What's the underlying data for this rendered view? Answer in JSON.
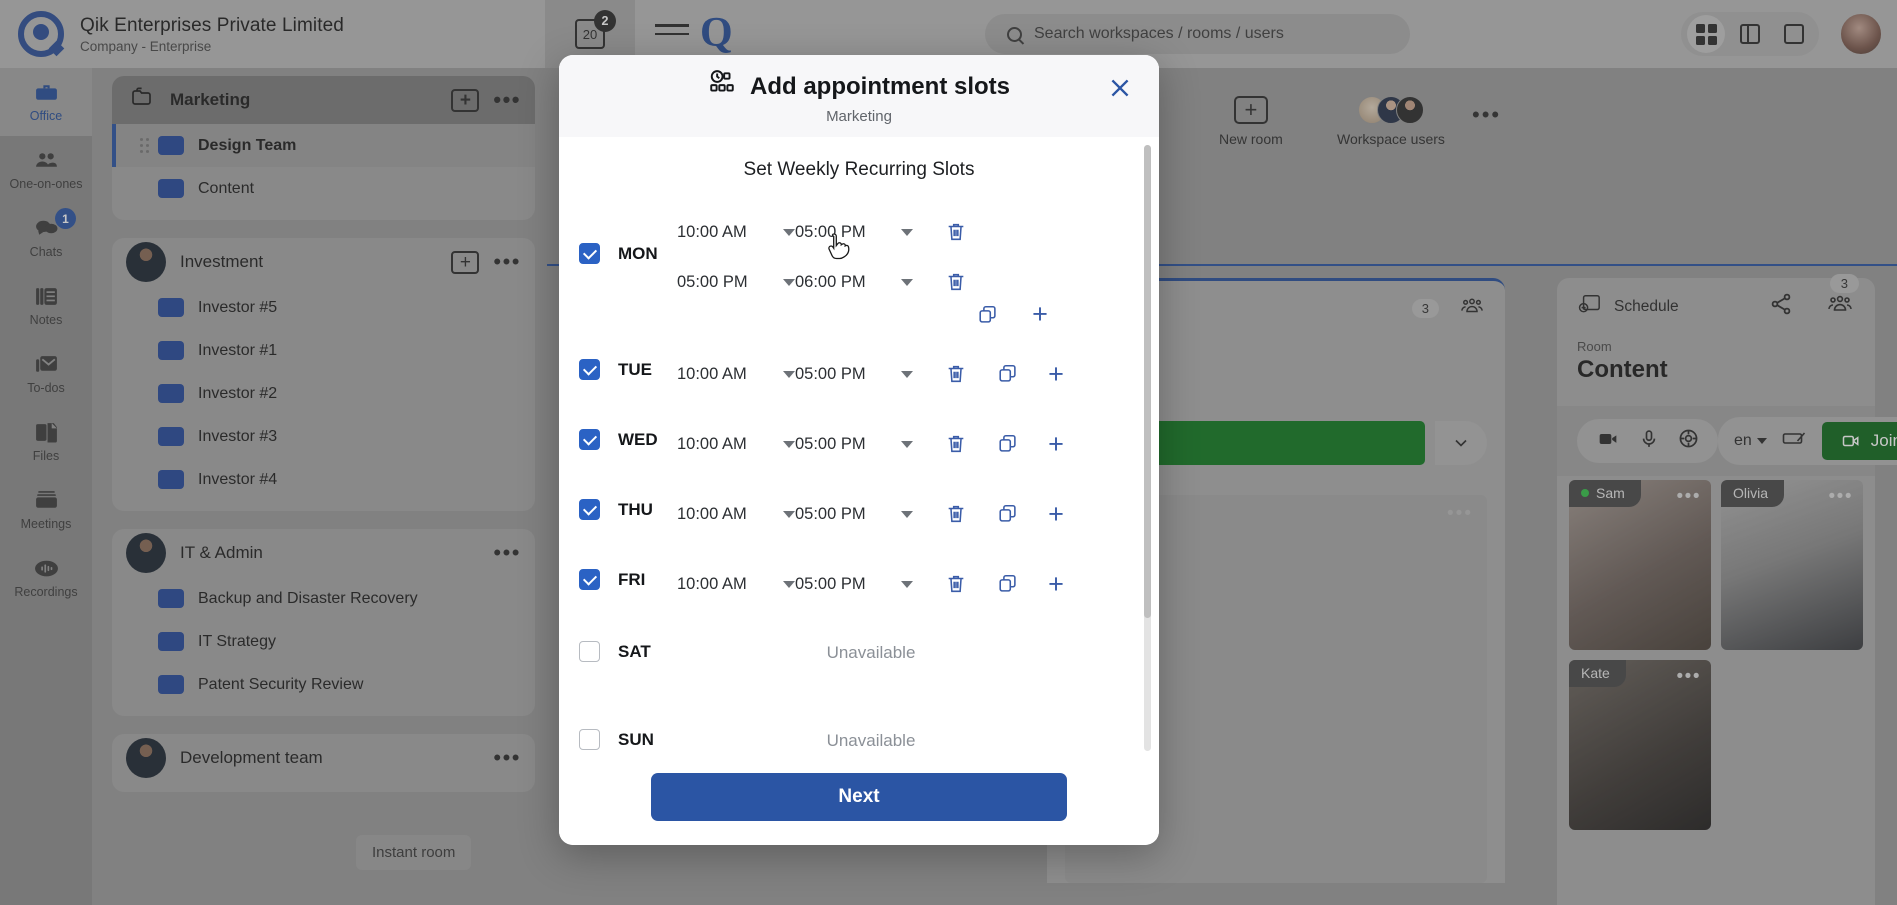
{
  "topbar": {
    "company_name": "Qik Enterprises Private Limited",
    "company_sub": "Company - Enterprise",
    "calendar_day": "20",
    "calendar_badge": "2",
    "search_placeholder": "Search workspaces / rooms / users"
  },
  "rail": {
    "items": [
      {
        "label": "Office",
        "icon": "briefcase-icon",
        "active": true,
        "badge": ""
      },
      {
        "label": "One-on-ones",
        "icon": "people-icon",
        "active": false,
        "badge": ""
      },
      {
        "label": "Chats",
        "icon": "chat-icon",
        "active": false,
        "badge": "1"
      },
      {
        "label": "Notes",
        "icon": "notes-icon",
        "active": false,
        "badge": ""
      },
      {
        "label": "To-dos",
        "icon": "todos-icon",
        "active": false,
        "badge": ""
      },
      {
        "label": "Files",
        "icon": "files-icon",
        "active": false,
        "badge": ""
      },
      {
        "label": "Meetings",
        "icon": "meetings-icon",
        "active": false,
        "badge": ""
      },
      {
        "label": "Recordings",
        "icon": "recordings-icon",
        "active": false,
        "badge": ""
      }
    ]
  },
  "rooms_panel": {
    "workspaces": [
      {
        "name": "Marketing",
        "icon": "folders-icon",
        "rooms": [
          {
            "name": "Design Team",
            "selected": true
          },
          {
            "name": "Content",
            "selected": false
          }
        ]
      },
      {
        "name": "Investment",
        "icon": "avatar",
        "rooms": [
          {
            "name": "Investor #5",
            "selected": false
          },
          {
            "name": "Investor #1",
            "selected": false
          },
          {
            "name": "Investor #2",
            "selected": false
          },
          {
            "name": "Investor #3",
            "selected": false
          },
          {
            "name": "Investor #4",
            "selected": false
          }
        ]
      },
      {
        "name": "IT & Admin",
        "icon": "avatar",
        "rooms": [
          {
            "name": "Backup and Disaster Recovery",
            "selected": false
          },
          {
            "name": "IT Strategy",
            "selected": false
          },
          {
            "name": "Patent Security Review",
            "selected": false
          }
        ]
      },
      {
        "name": "Development team",
        "icon": "avatar",
        "rooms": []
      }
    ],
    "instant_room_tooltip": "Instant room"
  },
  "stage": {
    "new_room_label": "New room",
    "workspace_users_label": "Workspace users",
    "schedule_card": {
      "title": "Schedule",
      "participants_count": "3"
    },
    "right_card": {
      "title": "Schedule",
      "participants_count": "3",
      "room_label": "Room",
      "room_name": "Content",
      "language": "en",
      "join_label": "Join",
      "tiles": [
        {
          "name": "Sam",
          "online": true
        },
        {
          "name": "Olivia",
          "online": false
        },
        {
          "name": "Kate",
          "online": false
        }
      ]
    }
  },
  "modal": {
    "icon": "appointment-slots-icon",
    "title": "Add appointment slots",
    "subtitle": "Marketing",
    "section_title": "Set Weekly Recurring Slots",
    "next_label": "Next",
    "unavailable_label": "Unavailable",
    "days": [
      {
        "day": "MON",
        "checked": true,
        "slots": [
          {
            "start": "10:00 AM",
            "end": "05:00 PM"
          },
          {
            "start": "05:00 PM",
            "end": "06:00 PM"
          }
        ]
      },
      {
        "day": "TUE",
        "checked": true,
        "slots": [
          {
            "start": "10:00 AM",
            "end": "05:00 PM"
          }
        ]
      },
      {
        "day": "WED",
        "checked": true,
        "slots": [
          {
            "start": "10:00 AM",
            "end": "05:00 PM"
          }
        ]
      },
      {
        "day": "THU",
        "checked": true,
        "slots": [
          {
            "start": "10:00 AM",
            "end": "05:00 PM"
          }
        ]
      },
      {
        "day": "FRI",
        "checked": true,
        "slots": [
          {
            "start": "10:00 AM",
            "end": "05:00 PM"
          }
        ]
      },
      {
        "day": "SAT",
        "checked": false,
        "slots": []
      },
      {
        "day": "SUN",
        "checked": false,
        "slots": []
      }
    ]
  },
  "colors": {
    "primary": "#2b55a4",
    "icon_blue": "#3a5ca8",
    "join_green": "#106b1d",
    "room_square": "#26499b"
  }
}
